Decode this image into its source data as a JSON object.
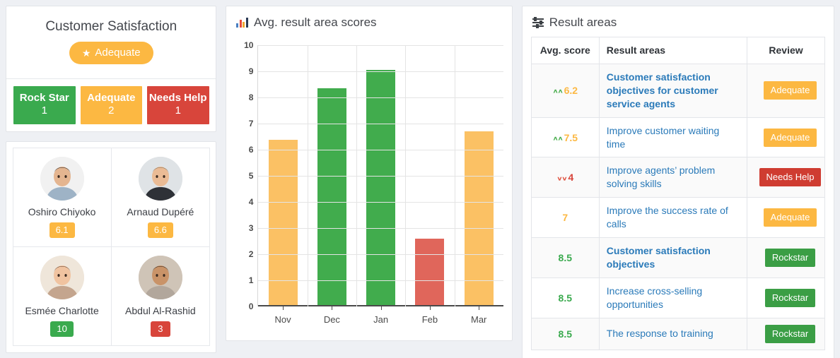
{
  "colors": {
    "green": "#3aaa4e",
    "orange": "#fcb842",
    "red": "#d8453b",
    "link_blue": "#2a7ab9",
    "bar_green": "#41ac4d",
    "bar_orange": "#fbc164",
    "bar_red": "#e0665b"
  },
  "satisfaction": {
    "title": "Customer Satisfaction",
    "badge": {
      "label": "Adequate",
      "icon": "star-icon",
      "color": "#fcb842"
    },
    "statuses": [
      {
        "label": "Rock Star",
        "count": "1",
        "color": "#3aaa4e"
      },
      {
        "label": "Adequate",
        "count": "2",
        "color": "#fcb842"
      },
      {
        "label": "Needs Help",
        "count": "1",
        "color": "#d8453b"
      }
    ]
  },
  "people": [
    {
      "name": "Oshiro Chiyoko",
      "score": "6.1",
      "color": "#fcb842"
    },
    {
      "name": "Arnaud Dupéré",
      "score": "6.6",
      "color": "#fcb842"
    },
    {
      "name": "Esmée Charlotte",
      "score": "10",
      "color": "#3aaa4e"
    },
    {
      "name": "Abdul Al-Rashid",
      "score": "3",
      "color": "#d8453b"
    }
  ],
  "chart_panel": {
    "title": "Avg. result area scores",
    "icon": "bar-chart-icon"
  },
  "chart_data": {
    "type": "bar",
    "title": "Avg. result area scores",
    "categories": [
      "Nov",
      "Dec",
      "Jan",
      "Feb",
      "Mar"
    ],
    "values": [
      6.37,
      8.35,
      9.05,
      2.6,
      6.7
    ],
    "bar_colors": [
      "#fbc164",
      "#41ac4d",
      "#41ac4d",
      "#e0665b",
      "#fbc164"
    ],
    "xlabel": "",
    "ylabel": "",
    "ylim": [
      0,
      10
    ],
    "yticks": [
      0,
      1,
      2,
      3,
      4,
      5,
      6,
      7,
      8,
      9,
      10
    ],
    "grid": true,
    "legend": false
  },
  "result_areas": {
    "title": "Result areas",
    "icon": "sliders-icon",
    "columns": [
      "Avg. score",
      "Result areas",
      "Review"
    ],
    "rows": [
      {
        "trend": "up",
        "score": "6.2",
        "score_color": "#fcb842",
        "area": "Customer satisfaction objectives for customer service agents",
        "bold": true,
        "review": "Adequate",
        "review_color": "#fcb842"
      },
      {
        "trend": "up",
        "score": "7.5",
        "score_color": "#fcb842",
        "area": "Improve customer waiting time",
        "bold": false,
        "review": "Adequate",
        "review_color": "#fcb842"
      },
      {
        "trend": "down",
        "score": "4",
        "score_color": "#d8453b",
        "area": "Improve agents’ problem solving skills",
        "bold": false,
        "review": "Needs Help",
        "review_color": "#cf3c31"
      },
      {
        "trend": "none",
        "score": "7",
        "score_color": "#fcb842",
        "area": "Improve the success rate of calls",
        "bold": false,
        "review": "Adequate",
        "review_color": "#fcb842"
      },
      {
        "trend": "none",
        "score": "8.5",
        "score_color": "#3aaa4e",
        "area": "Customer satisfaction objectives",
        "bold": true,
        "review": "Rockstar",
        "review_color": "#3b9e45"
      },
      {
        "trend": "none",
        "score": "8.5",
        "score_color": "#3aaa4e",
        "area": "Increase cross-selling opportunities",
        "bold": false,
        "review": "Rockstar",
        "review_color": "#3b9e45"
      },
      {
        "trend": "none",
        "score": "8.5",
        "score_color": "#3aaa4e",
        "area": "The response to training",
        "bold": false,
        "review": "Rockstar",
        "review_color": "#3b9e45"
      }
    ]
  }
}
